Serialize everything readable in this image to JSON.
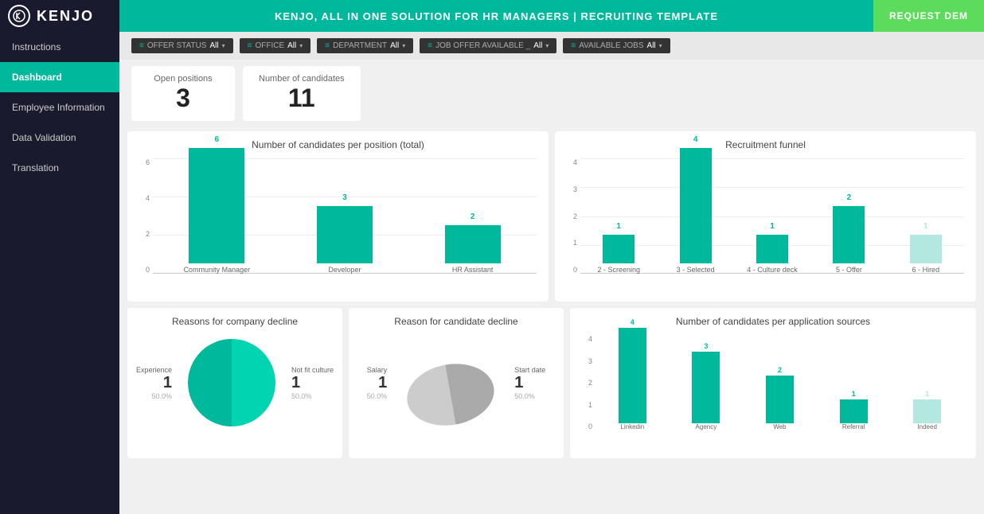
{
  "header": {
    "logo_text": "KENJO",
    "title": "KENJO, ALL IN ONE SOLUTION FOR HR MANAGERS | RECRUITING TEMPLATE",
    "cta": "REQUEST DEM"
  },
  "sidebar": {
    "items": [
      {
        "label": "Instructions",
        "active": false
      },
      {
        "label": "Dashboard",
        "active": true
      },
      {
        "label": "Employee Information",
        "active": false
      },
      {
        "label": "Data Validation",
        "active": false
      },
      {
        "label": "Translation",
        "active": false
      }
    ]
  },
  "filters": [
    {
      "label": "OFFER STATUS",
      "value": "All"
    },
    {
      "label": "OFFICE",
      "value": "All"
    },
    {
      "label": "DEPARTMENT",
      "value": "All"
    },
    {
      "label": "JOB OFFER AVAILABLE _",
      "value": "All"
    },
    {
      "label": "AVAILABLE JOBS",
      "value": "All"
    }
  ],
  "stats": [
    {
      "label": "Open positions",
      "value": "3"
    },
    {
      "label": "Number of candidates",
      "value": "11"
    }
  ],
  "candidates_per_position": {
    "title": "Number of candidates per position (total)",
    "bars": [
      {
        "label": "Community Manager",
        "value": 6
      },
      {
        "label": "Developer",
        "value": 3
      },
      {
        "label": "HR Assistant",
        "value": 2
      }
    ],
    "max": 6,
    "y_labels": [
      "6",
      "4",
      "2",
      "0"
    ]
  },
  "recruitment_funnel": {
    "title": "Recruitment funnel",
    "bars": [
      {
        "label": "2 - Screening",
        "value": 1,
        "light": false
      },
      {
        "label": "3 - Selected",
        "value": 4,
        "light": false
      },
      {
        "label": "4 - Culture deck",
        "value": 1,
        "light": false
      },
      {
        "label": "5 - Offer",
        "value": 2,
        "light": false
      },
      {
        "label": "6 - Hired",
        "value": 1,
        "light": true
      }
    ],
    "max": 4,
    "y_labels": [
      "4",
      "3",
      "2",
      "1",
      "0"
    ]
  },
  "company_decline": {
    "title": "Reasons for company decline",
    "slices": [
      {
        "label": "Experience",
        "pct": "50.0%",
        "value": "1"
      },
      {
        "label": "Not fit culture",
        "pct": "50.0%",
        "value": "1"
      }
    ]
  },
  "candidate_decline": {
    "title": "Reason for candidate decline",
    "slices": [
      {
        "label": "Salary",
        "pct": "50.0%",
        "value": "1"
      },
      {
        "label": "Start date",
        "pct": "50.0%",
        "value": "1"
      }
    ]
  },
  "app_sources": {
    "title": "Number of candidates per application sources",
    "bars": [
      {
        "label": "Linkedin",
        "value": 4,
        "light": false
      },
      {
        "label": "Agency",
        "value": 3,
        "light": false
      },
      {
        "label": "Web",
        "value": 2,
        "light": false
      },
      {
        "label": "Referral",
        "value": 1,
        "light": false
      },
      {
        "label": "Indeed",
        "value": 1,
        "light": true
      }
    ],
    "max": 4,
    "y_labels": [
      "4",
      "3",
      "2",
      "1",
      "0"
    ]
  }
}
